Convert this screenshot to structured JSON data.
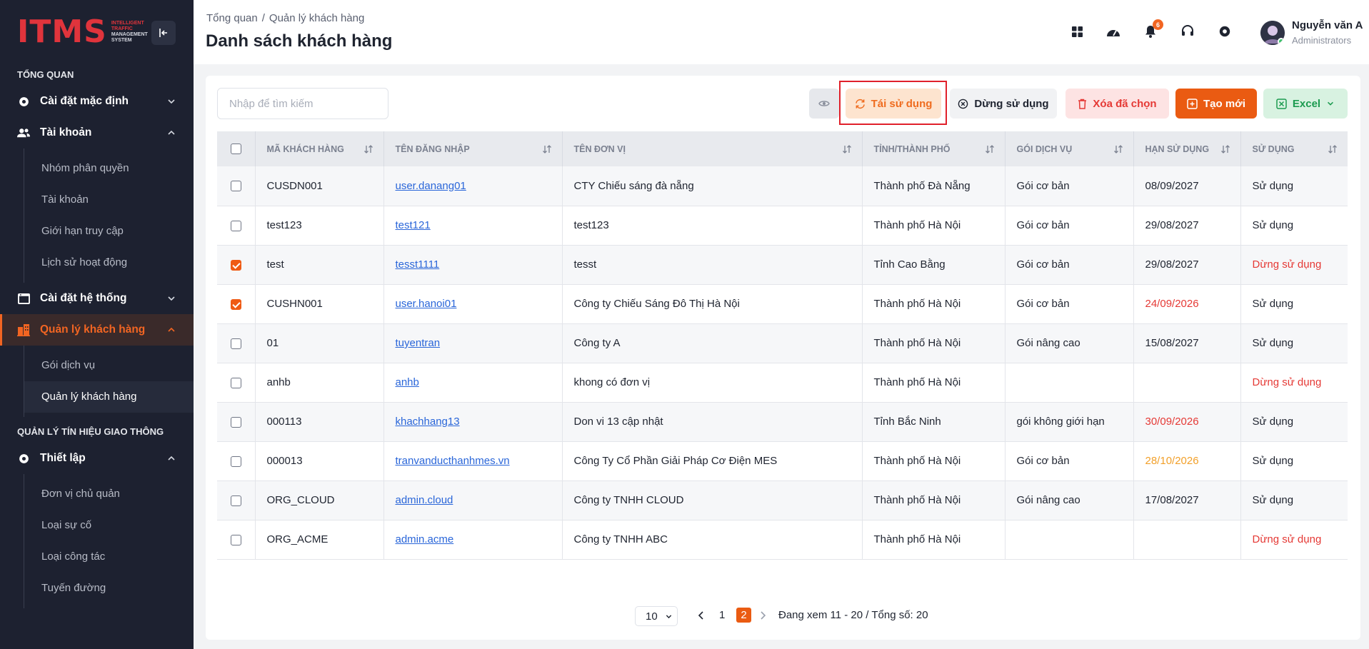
{
  "sidebar": {
    "logo": {
      "mark": "ITMS",
      "sub1": "INTELLIGENT",
      "sub2": "TRAFFIC",
      "sub3": "MANAGEMENT",
      "sub4": "SYSTEM"
    },
    "section_overview": "TỔNG QUAN",
    "default_settings": "Cài đặt mặc định",
    "accounts": "Tài khoản",
    "accounts_items": [
      "Nhóm phân quyền",
      "Tài khoản",
      "Giới hạn truy cập",
      "Lịch sử hoạt động"
    ],
    "system_settings": "Cài đặt hệ thống",
    "customer_mgmt": "Quản lý khách hàng",
    "customer_items": [
      "Gói dịch vụ",
      "Quản lý khách hàng"
    ],
    "section_traffic": "QUẢN LÝ TÍN HIỆU GIAO THÔNG",
    "setup": "Thiết lập",
    "setup_items": [
      "Đơn vị chủ quản",
      "Loại sự cố",
      "Loại công tác",
      "Tuyến đường"
    ]
  },
  "header": {
    "breadcrumb_home": "Tổng quan",
    "breadcrumb_sep": "/",
    "breadcrumb_current": "Quản lý khách hàng",
    "title": "Danh sách khách hàng",
    "notification_count": "6",
    "user_name": "Nguyễn văn A",
    "user_role": "Administrators"
  },
  "toolbar": {
    "search_placeholder": "Nhập để tìm kiếm",
    "reuse": "Tái sử dụng",
    "stop": "Dừng sử dụng",
    "delete_selected": "Xóa đã chọn",
    "create_new": "Tạo mới",
    "excel": "Excel"
  },
  "table": {
    "headers": [
      "MÃ KHÁCH HÀNG",
      "TÊN ĐĂNG NHẬP",
      "TÊN ĐƠN VỊ",
      "TỈNH/THÀNH PHỐ",
      "GÓI DỊCH VỤ",
      "HẠN SỬ DỤNG",
      "SỬ DỤNG"
    ],
    "rows": [
      {
        "checked": false,
        "code": "CUSDN001",
        "username": "user.danang01",
        "unit": "CTY Chiếu sáng đà nẵng",
        "city": "Thành phố Đà Nẵng",
        "package": "Gói cơ bản",
        "expiry": "08/09/2027",
        "status": "Sử dụng"
      },
      {
        "checked": false,
        "code": "test123",
        "username": "test121",
        "unit": "test123",
        "city": "Thành phố Hà Nội",
        "package": "Gói cơ bản",
        "expiry": "29/08/2027",
        "status": "Sử dụng"
      },
      {
        "checked": true,
        "code": "test",
        "username": "tesst1111",
        "unit": "tesst",
        "city": "Tỉnh Cao Bằng",
        "package": "Gói cơ bản",
        "expiry": "29/08/2027",
        "status": "Dừng sử dụng"
      },
      {
        "checked": true,
        "code": "CUSHN001",
        "username": "user.hanoi01",
        "unit": "Công ty Chiếu Sáng Đô Thị Hà Nội",
        "city": "Thành phố Hà Nội",
        "package": "Gói cơ bản",
        "expiry": "24/09/2026",
        "status": "Sử dụng"
      },
      {
        "checked": false,
        "code": "01",
        "username": "tuyentran",
        "unit": "Công ty A",
        "city": "Thành phố Hà Nội",
        "package": "Gói nâng cao",
        "expiry": "15/08/2027",
        "status": "Sử dụng"
      },
      {
        "checked": false,
        "code": "anhb",
        "username": "anhb",
        "unit": "khong có đơn vị",
        "city": "Thành phố Hà Nội",
        "package": "",
        "expiry": "",
        "status": "Dừng sử dụng"
      },
      {
        "checked": false,
        "code": "000113",
        "username": "khachhang13",
        "unit": "Don vi 13 cập nhật",
        "city": "Tỉnh Bắc Ninh",
        "package": "gói không giới hạn",
        "expiry": "30/09/2026",
        "status": "Sử dụng"
      },
      {
        "checked": false,
        "code": "000013",
        "username": "tranvanducthanhmes.vn",
        "unit": "Công Ty Cổ Phần Giải Pháp Cơ Điện MES",
        "city": "Thành phố Hà Nội",
        "package": "Gói cơ bản",
        "expiry": "28/10/2026",
        "status": "Sử dụng"
      },
      {
        "checked": false,
        "code": "ORG_CLOUD",
        "username": "admin.cloud",
        "unit": "Công ty TNHH CLOUD",
        "city": "Thành phố Hà Nội",
        "package": "Gói nâng cao",
        "expiry": "17/08/2027",
        "status": "Sử dụng"
      },
      {
        "checked": false,
        "code": "ORG_ACME",
        "username": "admin.acme",
        "unit": "Công ty TNHH ABC",
        "city": "Thành phố Hà Nội",
        "package": "",
        "expiry": "",
        "status": "Dừng sử dụng"
      }
    ]
  },
  "pagination": {
    "page_size": "10",
    "page_1": "1",
    "page_2": "2",
    "info": "Đang xem 11 - 20 / Tổng số: 20"
  },
  "colors": {
    "accent": "#ea5b12",
    "sidebar_bg": "#1d2130",
    "danger": "#e53935",
    "warning": "#f2a02a",
    "link": "#2a66d9"
  }
}
